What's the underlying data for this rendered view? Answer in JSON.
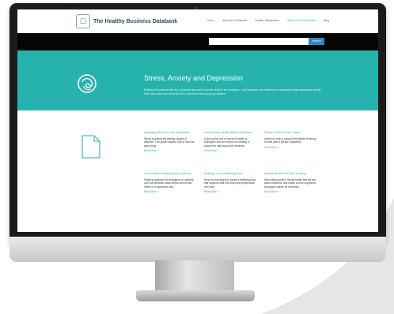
{
  "site": {
    "logo_text": "The Healthy Business Databank",
    "nav": [
      "Home",
      "About the Databank",
      "Healthy Workplaces",
      "Stress & Mental Health",
      "Blog"
    ],
    "active_nav_index": 3,
    "search_placeholder": "",
    "search_button": "Search",
    "accent_color": "#26b3ae"
  },
  "hero": {
    "title": "Stress, Anxiety and Depression",
    "description": "Building the business case for a proactive approach to mental health in the workplace - how investing in the wellbeing of employees brings measurable returns. More information can be found on the resources below to get you started.",
    "icon": "brain-icon"
  },
  "cards": [
    {
      "title": "Managing Stress in the Workplace",
      "body": "Stress is among the leading causes of absence. This guide explains how to spot the signs early.",
      "more": "Read More >"
    },
    {
      "title": "How Mental Health Affects Business",
      "body": "A look at the cost of mental ill health to employers and the returns of investing in support for staff across the business.",
      "more": "Read More >"
    },
    {
      "title": "Return to Work After Stress",
      "body": "Advice on how to support employees returning to work after a period of absence.",
      "more": "Read More >"
    },
    {
      "title": "How to Start Talking About a Stress",
      "body": "Practical guidance for managers on opening up a conversation about stress and mental health in a supportive way.",
      "more": "Read More >"
    },
    {
      "title": "Building Your Wellbeing Plan",
      "body": "Steps for employers to create a wellbeing plan that supports staff and improves performance over time.",
      "more": "Read More >"
    },
    {
      "title": "Mental Health First Aid Training",
      "body": "How training staff in mental health first aid can build confidence and create a more supportive workplace culture for everyone.",
      "more": "Read More >"
    }
  ]
}
